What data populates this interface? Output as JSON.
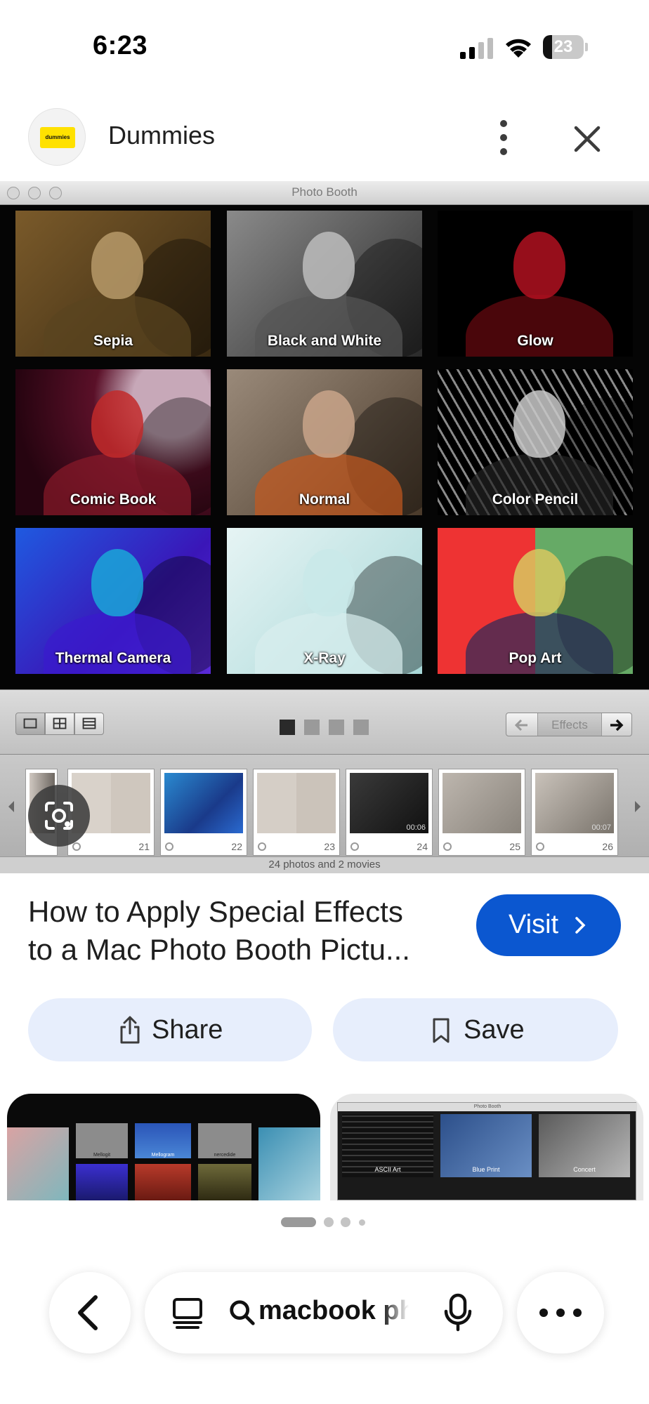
{
  "status_bar": {
    "time": "6:23",
    "battery": "23",
    "battery_level": 0.23
  },
  "header": {
    "source_name": "Dummies",
    "logo_text": "dummies"
  },
  "photo_booth": {
    "window_title": "Photo Booth",
    "effects": [
      "Sepia",
      "Black and White",
      "Glow",
      "Comic Book",
      "Normal",
      "Color Pencil",
      "Thermal Camera",
      "X-Ray",
      "Pop Art"
    ],
    "effects_button": "Effects",
    "thumbnails": [
      {
        "number": "21",
        "duration": ""
      },
      {
        "number": "22",
        "duration": ""
      },
      {
        "number": "23",
        "duration": ""
      },
      {
        "number": "24",
        "duration": "00:06"
      },
      {
        "number": "25",
        "duration": ""
      },
      {
        "number": "26",
        "duration": "00:07"
      }
    ],
    "status": "24 photos and 2 movies"
  },
  "result": {
    "title_line1": "How to Apply Special Effects",
    "title_line2": "to a Mac Photo Booth Pictu...",
    "visit_label": "Visit"
  },
  "actions": {
    "share_label": "Share",
    "save_label": "Save"
  },
  "related": {
    "first": {
      "labels": [
        "Mellogit",
        "Mellogram",
        "nercedide"
      ]
    },
    "second": {
      "window_title": "Photo Booth",
      "labels": [
        "ASCII Art",
        "Blue Print",
        "Concert"
      ]
    }
  },
  "bottom_bar": {
    "search_query": "macbook photo booth"
  },
  "colors": {
    "accent": "#0b57d0",
    "chip_bg": "#e7eefc",
    "logo_yellow": "#ffe100"
  }
}
